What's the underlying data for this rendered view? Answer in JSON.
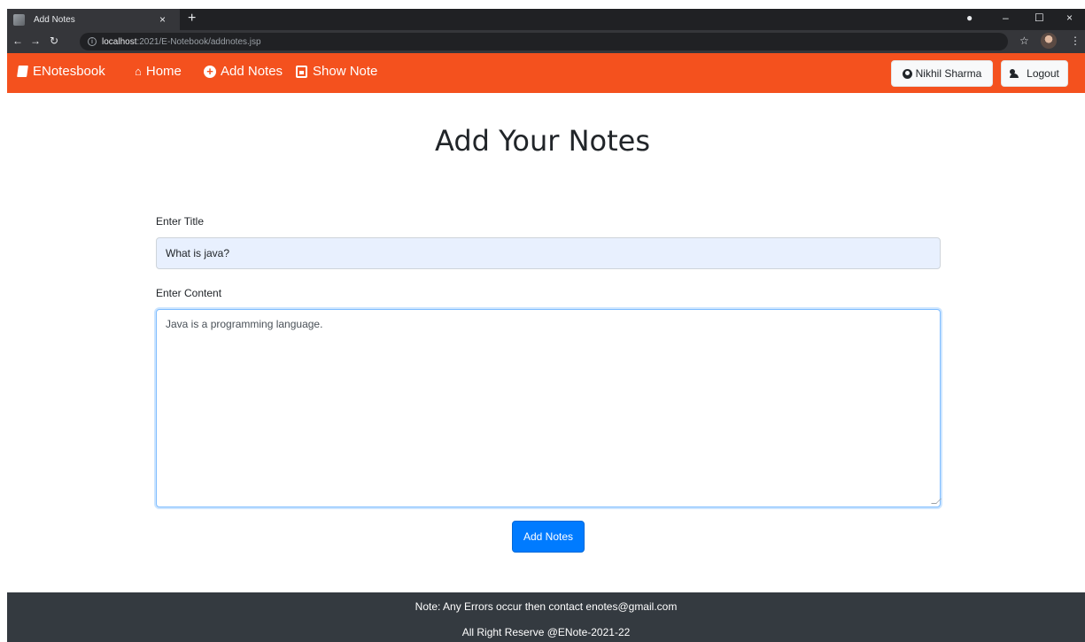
{
  "browser": {
    "tab_title": "Add Notes",
    "tab_close": "×",
    "new_tab": "+",
    "url_host": "localhost",
    "url_path": ":2021/E-Notebook/addnotes.jsp",
    "info_icon_glyph": "i",
    "controls": {
      "minimize": "–",
      "maximize": "☐",
      "close": "×"
    }
  },
  "navbar": {
    "brand": "ENotesbook",
    "links": [
      {
        "label": "Home",
        "icon": "home-icon"
      },
      {
        "label": "Add Notes",
        "icon": "plus-circle-icon"
      },
      {
        "label": "Show Note",
        "icon": "note-icon"
      }
    ],
    "user_button": "Nikhil Sharma",
    "logout_button": "Logout",
    "accent_color": "#f4511e"
  },
  "main": {
    "heading": "Add Your Notes",
    "title_label": "Enter Title",
    "title_value": "What is java?",
    "content_label": "Enter Content",
    "content_value": "Java is a programming language.",
    "submit_label": "Add Notes",
    "button_color": "#007bff"
  },
  "footer": {
    "note": "Note: Any Errors occur then contact enotes@gmail.com",
    "rights": "All Right Reserve @ENote-2021-22",
    "background": "#343a40"
  }
}
